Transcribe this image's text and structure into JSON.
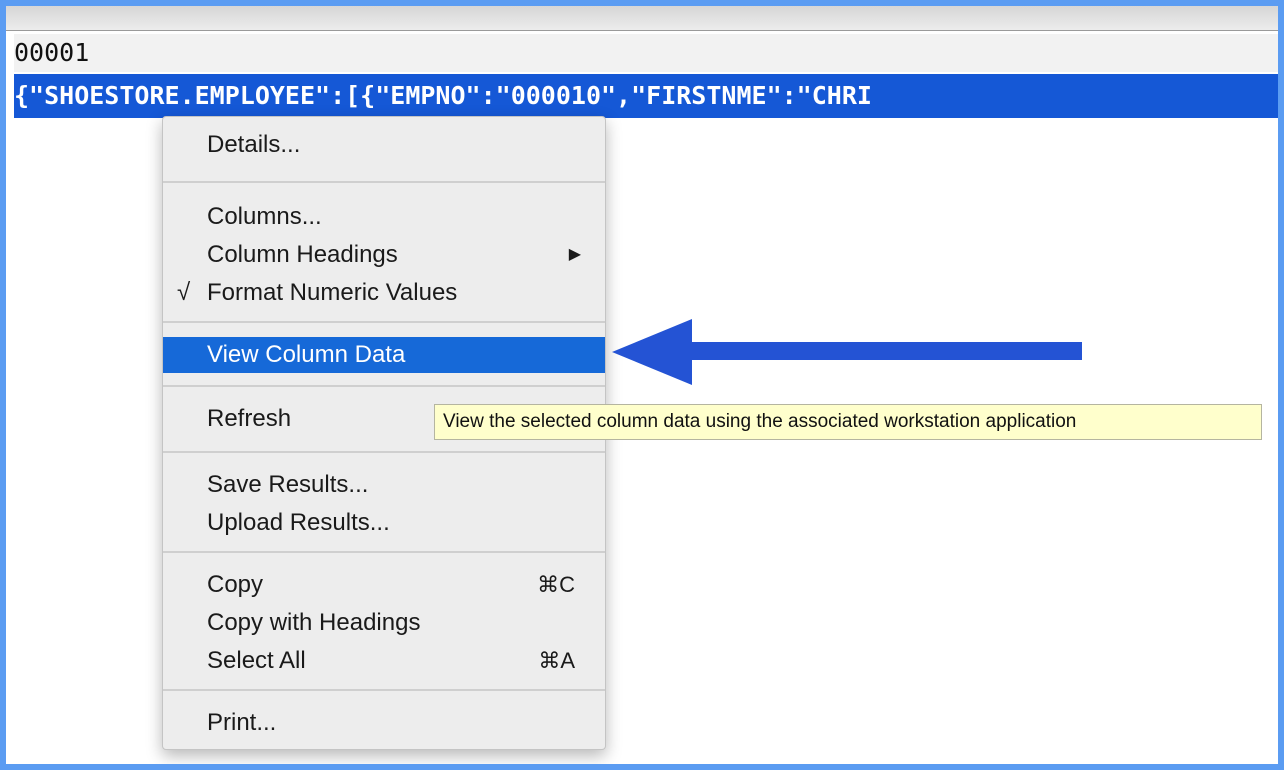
{
  "results": {
    "row_number": "00001",
    "json_value": "{\"SHOESTORE.EMPLOYEE\":[{\"EMPNO\":\"000010\",\"FIRSTNME\":\"CHRI"
  },
  "context_menu": {
    "items": [
      {
        "label": "Details..."
      },
      {
        "label": "Columns..."
      },
      {
        "label": "Column Headings"
      },
      {
        "label": "Format Numeric Values",
        "checked": true
      },
      {
        "label": "View Column Data",
        "highlighted": true
      },
      {
        "label": "Refresh"
      },
      {
        "label": "Save Results..."
      },
      {
        "label": "Upload Results..."
      },
      {
        "label": "Copy",
        "shortcut": "⌘C"
      },
      {
        "label": "Copy with Headings"
      },
      {
        "label": "Select All",
        "shortcut": "⌘A"
      },
      {
        "label": "Print..."
      }
    ],
    "check_glyph": "√",
    "submenu_glyph": "▶"
  },
  "tooltip": {
    "text": "View the selected column data using the associated workstation application"
  },
  "colors": {
    "frame_border": "#5b9cf2",
    "selection": "#1558d6",
    "menu_highlight": "#1669d8",
    "annotation_arrow": "#2453d4",
    "tooltip_bg": "#ffffcc"
  },
  "icons": {
    "annotation": "left-arrow-icon"
  }
}
